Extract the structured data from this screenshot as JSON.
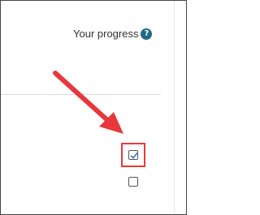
{
  "progress_header": {
    "label": "Your progress",
    "help_icon": "?"
  },
  "completion": {
    "items": [
      {
        "state": "checked",
        "icon": "checkbox-checked-icon"
      },
      {
        "state": "unchecked",
        "icon": "checkbox-unchecked-icon"
      }
    ]
  },
  "annotation": {
    "arrow_color": "#e8383c",
    "highlight_color": "#e8383c"
  },
  "colors": {
    "help_icon_bg": "#1f6a86",
    "check_color": "#3b6fd4"
  }
}
